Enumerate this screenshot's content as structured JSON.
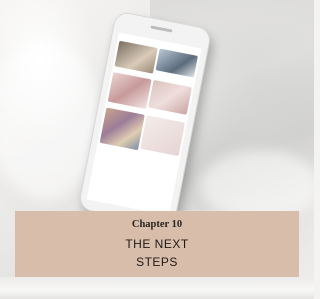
{
  "photo": {
    "description_icon": "phone-mockup-icon"
  },
  "banner": {
    "chapter": "Chapter 10",
    "title_line_1": "THE NEXT",
    "title_line_2": "STEPS"
  }
}
